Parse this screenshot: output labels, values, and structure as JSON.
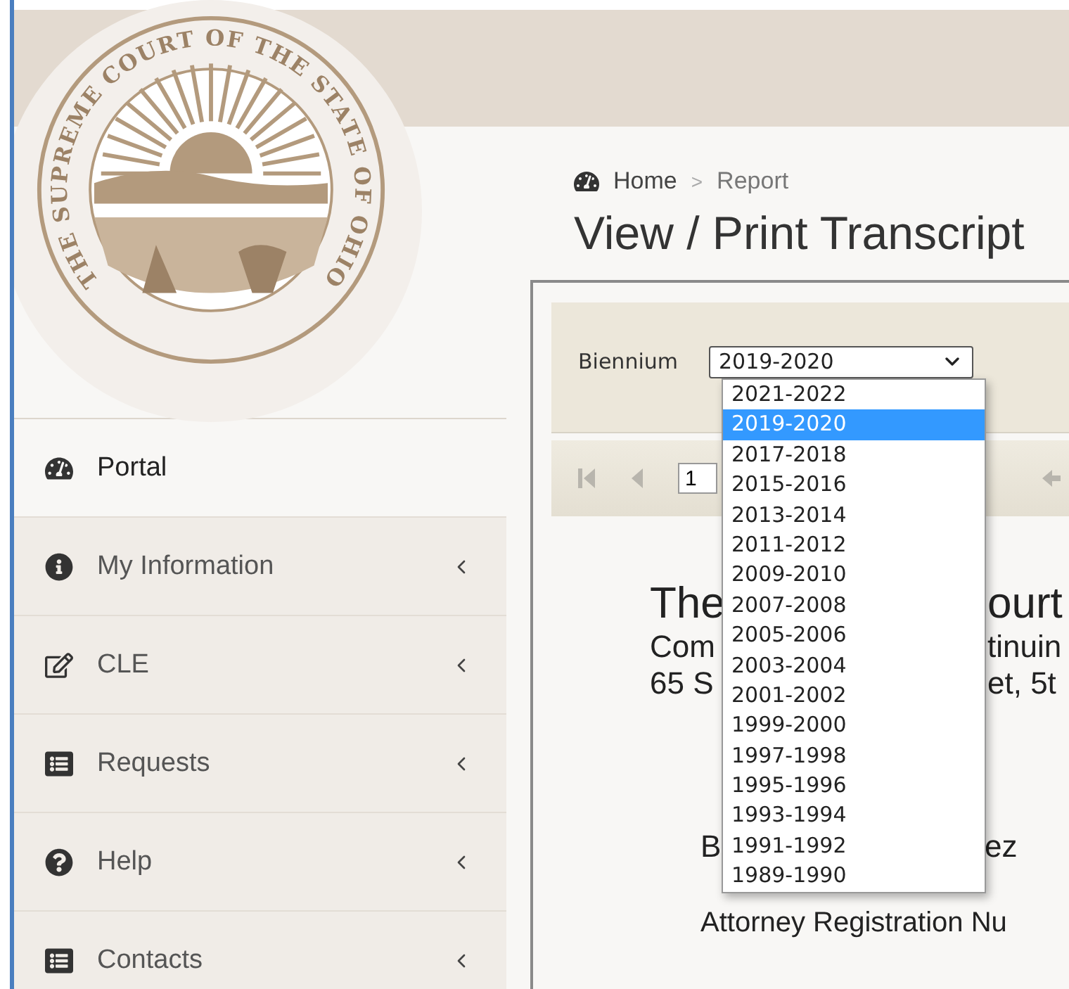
{
  "seal_text": "THE SUPREME COURT OF THE STATE OF OHIO",
  "sidebar": {
    "items": [
      {
        "label": "Portal",
        "selected": true,
        "has_submenu": false
      },
      {
        "label": "My Information",
        "selected": false,
        "has_submenu": true
      },
      {
        "label": "CLE",
        "selected": false,
        "has_submenu": true
      },
      {
        "label": "Requests",
        "selected": false,
        "has_submenu": true
      },
      {
        "label": "Help",
        "selected": false,
        "has_submenu": true
      },
      {
        "label": "Contacts",
        "selected": false,
        "has_submenu": true
      }
    ]
  },
  "breadcrumb": [
    {
      "label": "Home",
      "current": false
    },
    {
      "label": "Report",
      "current": true
    }
  ],
  "breadcrumb_separator": ">",
  "page_title": "View / Print Transcript",
  "filter": {
    "label": "Biennium",
    "value": "2019-2020",
    "expanded": true,
    "options": [
      {
        "label": "2021-2022",
        "selected": false
      },
      {
        "label": "2019-2020",
        "selected": true
      },
      {
        "label": "2017-2018",
        "selected": false
      },
      {
        "label": "2015-2016",
        "selected": false
      },
      {
        "label": "2013-2014",
        "selected": false
      },
      {
        "label": "2011-2012",
        "selected": false
      },
      {
        "label": "2009-2010",
        "selected": false
      },
      {
        "label": "2007-2008",
        "selected": false
      },
      {
        "label": "2005-2006",
        "selected": false
      },
      {
        "label": "2003-2004",
        "selected": false
      },
      {
        "label": "2001-2002",
        "selected": false
      },
      {
        "label": "1999-2000",
        "selected": false
      },
      {
        "label": "1997-1998",
        "selected": false
      },
      {
        "label": "1995-1996",
        "selected": false
      },
      {
        "label": "1993-1994",
        "selected": false
      },
      {
        "label": "1991-1992",
        "selected": false
      },
      {
        "label": "1989-1990",
        "selected": false
      }
    ]
  },
  "pager": {
    "page": "1"
  },
  "report": {
    "lines": [
      {
        "kind": "heading",
        "left": "The",
        "right": "ourt"
      },
      {
        "kind": "body",
        "left": "Com",
        "right": "tinuin"
      },
      {
        "kind": "body",
        "left": "65 S",
        "right": "et, 5t"
      },
      {
        "kind": "name",
        "left": "B",
        "right": "ez"
      },
      {
        "kind": "registration",
        "text": "Attorney Registration Nu"
      }
    ]
  }
}
